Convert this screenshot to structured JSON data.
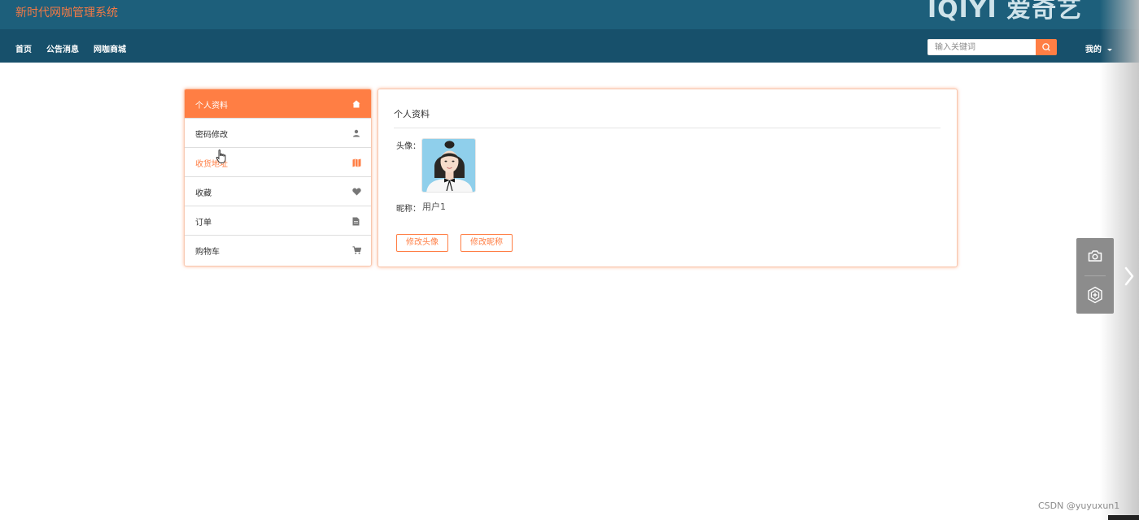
{
  "app": {
    "title": "新时代网咖管理系统",
    "brand_mark": "IQIYI 爱奇艺"
  },
  "nav": {
    "links": [
      "首页",
      "公告消息",
      "网咖商城"
    ]
  },
  "search": {
    "placeholder": "输入关键词",
    "icon": "search-icon"
  },
  "user_menu": {
    "label": "我的"
  },
  "sidebar": {
    "items": [
      {
        "label": "个人资料",
        "icon": "home-icon",
        "state": "active"
      },
      {
        "label": "密码修改",
        "icon": "user-icon"
      },
      {
        "label": "收货地址",
        "icon": "map-icon",
        "state": "hover"
      },
      {
        "label": "收藏",
        "icon": "heart-icon"
      },
      {
        "label": "订单",
        "icon": "file-icon"
      },
      {
        "label": "购物车",
        "icon": "cart-icon"
      }
    ]
  },
  "profile": {
    "title": "个人资料",
    "avatar_label": "头像：",
    "nickname_label": "昵称：",
    "nickname": "用户1",
    "change_avatar_label": "修改头像",
    "change_nickname_label": "修改昵称"
  },
  "colors": {
    "accent": "#ff7e44",
    "topbar": "#1d5f7b",
    "navbar": "#17506b"
  },
  "overlay": {
    "tools": [
      "camera-icon",
      "hexagon-plus-icon",
      "chevron-right-icon"
    ],
    "watermark": "CSDN @yuyuxun1"
  }
}
